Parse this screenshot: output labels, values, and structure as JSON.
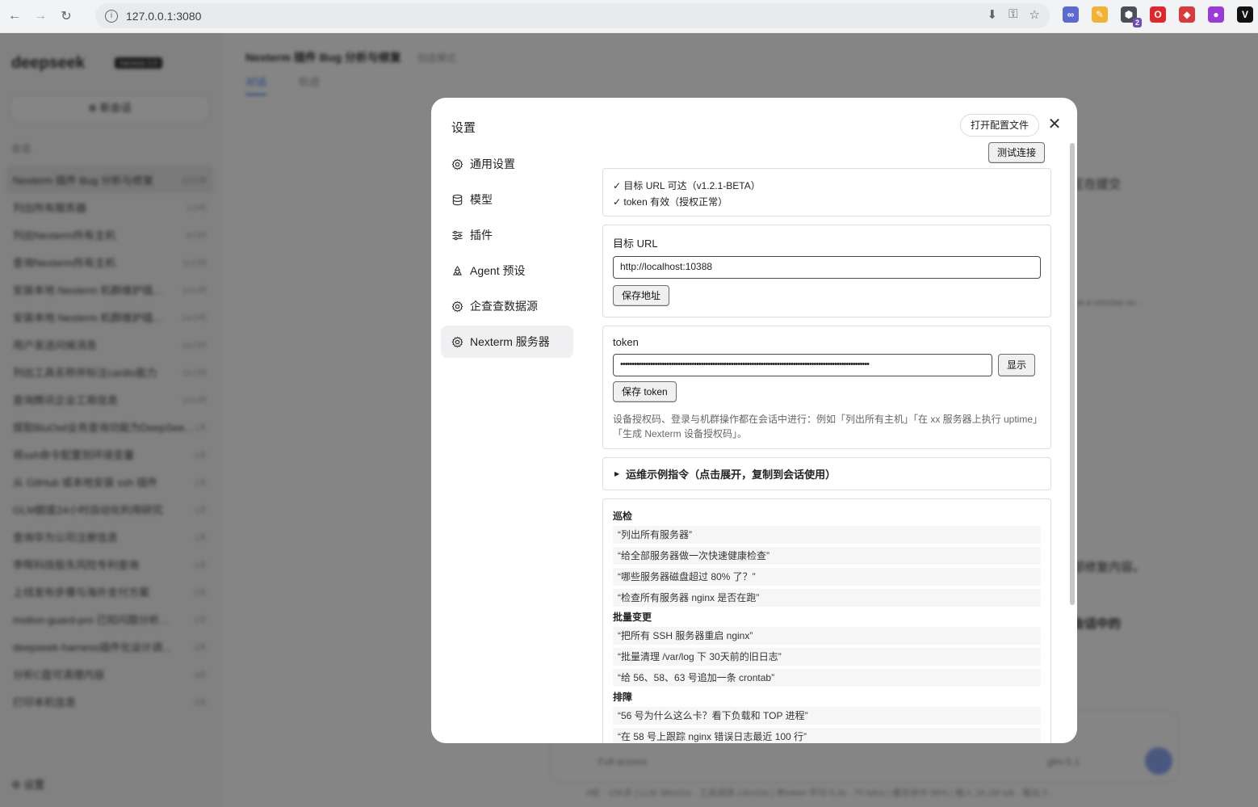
{
  "browser": {
    "url": "127.0.0.1:3080",
    "extensions": [
      {
        "name": "link-extension-icon",
        "color": "#5b6ad0",
        "glyph": "∞"
      },
      {
        "name": "brush-extension-icon",
        "color": "#f2b233",
        "glyph": "✎"
      },
      {
        "name": "shield-extension-icon",
        "color": "#4a4f58",
        "glyph": "⬢",
        "badge": "2"
      },
      {
        "name": "opera-extension-icon",
        "color": "#e0272a",
        "glyph": "O"
      },
      {
        "name": "dice-extension-icon",
        "color": "#d93a3a",
        "glyph": "◆"
      },
      {
        "name": "purple-extension-icon",
        "color": "#9b3ad6",
        "glyph": "●"
      },
      {
        "name": "v-extension-icon",
        "color": "#111111",
        "glyph": "V"
      }
    ]
  },
  "sidebar": {
    "brand": "deepseek",
    "brand_badge": "harness 2.0",
    "new_chat": "新会话",
    "conversations_label": "会话",
    "conversations": [
      {
        "title": "Nexterm 插件 Bug 分析与修复",
        "time": "42分钟"
      },
      {
        "title": "列出所有服务器",
        "time": "1小时"
      },
      {
        "title": "列出Nexterm所有主机",
        "time": "9小时"
      },
      {
        "title": "查询Nexterm所有主机",
        "time": "11小时"
      },
      {
        "title": "安装本地 Nexterm 机群维护插...",
        "time": "14小时"
      },
      {
        "title": "安装本地 Nexterm 机群维护插...",
        "time": "14小时"
      },
      {
        "title": "用户发送问候消息",
        "time": "15小时"
      },
      {
        "title": "列出工具名称并标注cardio能力",
        "time": "15小时"
      },
      {
        "title": "查询腾讯企业工商信息",
        "time": "15小时"
      },
      {
        "title": "提取BiuOwl业务查询功能为DeepSee...",
        "time": "1天"
      },
      {
        "title": "将ssh命令配置到环境变量",
        "time": "1天"
      },
      {
        "title": "从 GitHub 或本地安装 ssh 插件",
        "time": "1天"
      },
      {
        "title": "GLM额度24小时自动化利用研究",
        "time": "1天"
      },
      {
        "title": "查询华为公司注册信息",
        "time": "1天"
      },
      {
        "title": "李晖科技股东风险专利查询",
        "time": "2天"
      },
      {
        "title": "上线发布步骤与海外支付方案",
        "time": "2天"
      },
      {
        "title": "motion-guard-pro 已知问题分析...",
        "time": "2天"
      },
      {
        "title": "deepseek-harness插件化设计调...",
        "time": "3天"
      },
      {
        "title": "分析C盘可清理内容",
        "time": "3天"
      },
      {
        "title": "打印本机信息",
        "time": "3天"
      }
    ],
    "settings": "设置"
  },
  "main": {
    "title": "Nexterm 插件 Bug 分析与修复",
    "mode": "创造模式",
    "tabs": [
      "对话",
      "轨迹"
    ],
    "bg_line_1": "正在提交",
    "bg_line_2": "ive a concise su...",
    "bg_line_3": "部修复内容。",
    "bg_line_4": "会话中的",
    "composer_mode": "Full access",
    "model": "glm-5.1",
    "status_bar": "4轮 · 15K步 | LLM 38m21s · 工具调用 13m10s | 单token 平均 5.3s · 70 tok/s | 缓存命中 96% | 输入 16.1M tok · 输出 5..."
  },
  "modal": {
    "title": "设置",
    "open_config": "打开配置文件",
    "menu": [
      {
        "label": "通用设置",
        "icon": "gear-icon"
      },
      {
        "label": "模型",
        "icon": "database-icon"
      },
      {
        "label": "插件",
        "icon": "sliders-icon"
      },
      {
        "label": "Agent 预设",
        "icon": "recycle-icon"
      },
      {
        "label": "企查查数据源",
        "icon": "gear-icon"
      },
      {
        "label": "Nexterm 服务器",
        "icon": "gear-icon",
        "active": true
      }
    ],
    "test_connection": "测试连接",
    "status_lines": [
      "✓ 目标 URL 可达（v1.2.1-BETA）",
      "✓ token 有效（授权正常）"
    ],
    "url_label": "目标 URL",
    "url_value": "http://localhost:10388",
    "save_url": "保存地址",
    "token_label": "token",
    "token_value": "••••••••••••••••••••••••••••••••••••••••••••••••••••••••••••••••••••••••••••••••••••••••••••••••••••••••••••",
    "show": "显示",
    "save_token": "保存 token",
    "hint": "设备授权码、登录与机群操作都在会话中进行：例如「列出所有主机」「在 xx 服务器上执行 uptime」「生成 Nexterm 设备授权码」。",
    "examples_summary": "运维示例指令（点击展开，复制到会话使用）",
    "example_groups": [
      {
        "title": "巡检",
        "items": [
          "“列出所有服务器”",
          "“给全部服务器做一次快速健康检查”",
          "“哪些服务器磁盘超过 80% 了？”",
          "“检查所有服务器 nginx 是否在跑”"
        ]
      },
      {
        "title": "批量变更",
        "items": [
          "“把所有 SSH 服务器重启 nginx”",
          "“批量清理 /var/log 下 30天前的旧日志”",
          "“给 56、58、63 号追加一条 crontab”"
        ]
      },
      {
        "title": "排障",
        "items": [
          "“56 号为什么这么卡？看下负载和 TOP 进程”",
          "“在 58 号上跟踪 nginx 错误日志最近 100 行”"
        ]
      }
    ]
  }
}
